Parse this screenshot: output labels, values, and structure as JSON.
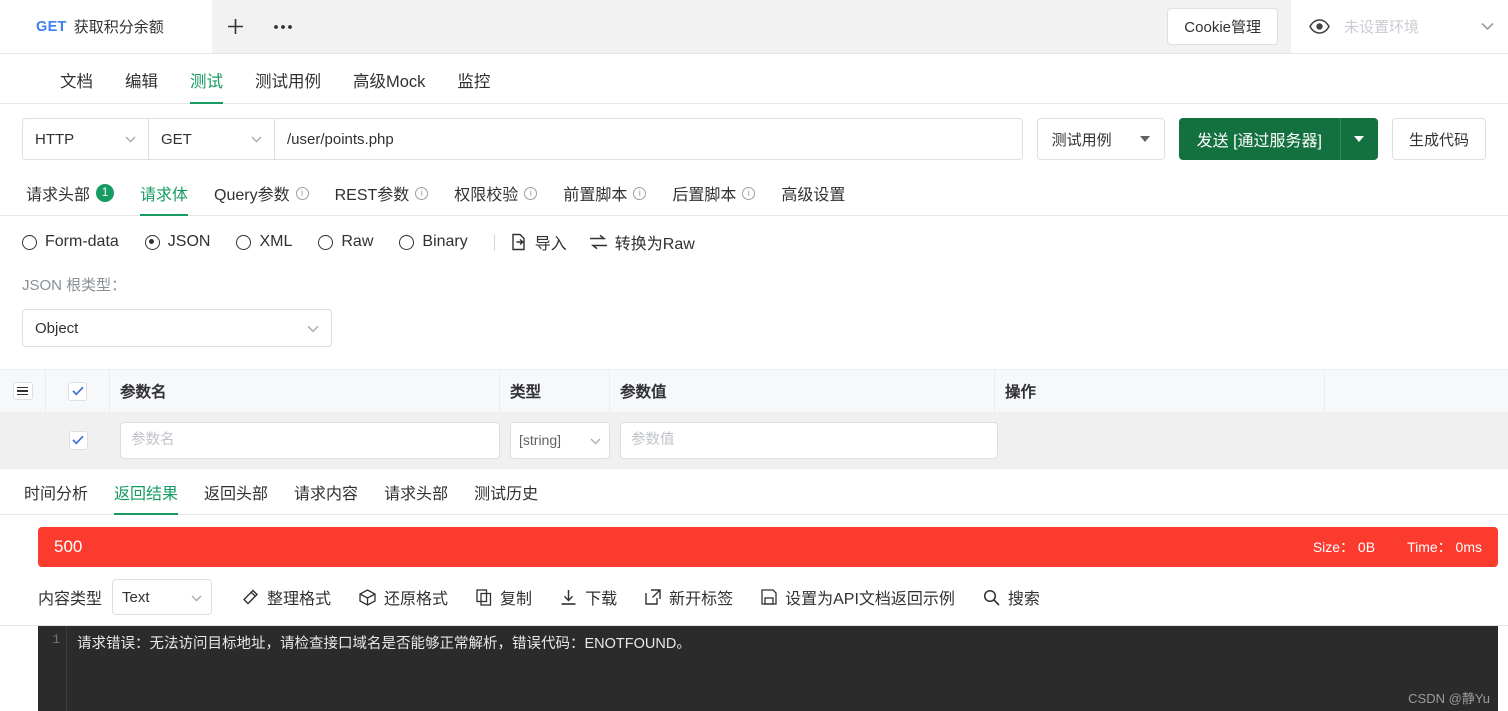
{
  "tabstrip": {
    "doc_tab": {
      "method": "GET",
      "title": "获取积分余额"
    },
    "add_label": "+",
    "more_label": "•••",
    "cookie_button": "Cookie管理",
    "env_placeholder": "未设置环境",
    "eye_icon": "eye-icon",
    "caret_icon": "chevron-down-icon"
  },
  "main_tabs": [
    {
      "label": "文档",
      "active": false
    },
    {
      "label": "编辑",
      "active": false
    },
    {
      "label": "测试",
      "active": true
    },
    {
      "label": "测试用例",
      "active": false
    },
    {
      "label": "高级Mock",
      "active": false
    },
    {
      "label": "监控",
      "active": false
    }
  ],
  "urlbar": {
    "protocol": "HTTP",
    "method": "GET",
    "url_value": "/user/points.php",
    "url_placeholder": "",
    "case_button": "测试用例",
    "send_button": "发送 [通过服务器]",
    "gen_code_button": "生成代码"
  },
  "request_tabs": [
    {
      "label": "请求头部",
      "badge": "1",
      "info": false,
      "active": false
    },
    {
      "label": "请求体",
      "badge": "",
      "info": false,
      "active": true
    },
    {
      "label": "Query参数",
      "badge": "",
      "info": true,
      "active": false
    },
    {
      "label": "REST参数",
      "badge": "",
      "info": true,
      "active": false
    },
    {
      "label": "权限校验",
      "badge": "",
      "info": true,
      "active": false
    },
    {
      "label": "前置脚本",
      "badge": "",
      "info": true,
      "active": false
    },
    {
      "label": "后置脚本",
      "badge": "",
      "info": true,
      "active": false
    },
    {
      "label": "高级设置",
      "badge": "",
      "info": false,
      "active": false
    }
  ],
  "body_types": {
    "options": [
      {
        "label": "Form-data",
        "selected": false
      },
      {
        "label": "JSON",
        "selected": true
      },
      {
        "label": "XML",
        "selected": false
      },
      {
        "label": "Raw",
        "selected": false
      },
      {
        "label": "Binary",
        "selected": false
      }
    ],
    "import_label": "导入",
    "convert_label": "转换为Raw"
  },
  "json_root": {
    "label": "JSON 根类型：",
    "selected": "Object"
  },
  "param_table": {
    "headers": {
      "name": "参数名",
      "type": "类型",
      "value": "参数值",
      "action": "操作"
    },
    "rows": [
      {
        "checked": true,
        "name_placeholder": "参数名",
        "type": "[string]",
        "value_placeholder": "参数值"
      }
    ]
  },
  "response_tabs": [
    {
      "label": "时间分析",
      "active": false
    },
    {
      "label": "返回结果",
      "active": true
    },
    {
      "label": "返回头部",
      "active": false
    },
    {
      "label": "请求内容",
      "active": false
    },
    {
      "label": "请求头部",
      "active": false
    },
    {
      "label": "测试历史",
      "active": false
    }
  ],
  "status": {
    "code": "500",
    "size": "Size： 0B",
    "time": "Time： 0ms",
    "color": "#fb3b2e"
  },
  "response_toolbar": {
    "content_type_label": "内容类型",
    "content_type_value": "Text",
    "actions": [
      {
        "label": "整理格式",
        "icon": "magic-wand-icon"
      },
      {
        "label": "还原格式",
        "icon": "box-icon"
      },
      {
        "label": "复制",
        "icon": "copy-icon"
      },
      {
        "label": "下载",
        "icon": "download-icon"
      },
      {
        "label": "新开标签",
        "icon": "external-link-icon"
      },
      {
        "label": "设置为API文档返回示例",
        "icon": "save-icon"
      },
      {
        "label": "搜索",
        "icon": "search-icon"
      }
    ]
  },
  "code": {
    "line_number": "1",
    "text": "请求错误：无法访问目标地址，请检查接口域名是否能够正常解析，错误代码：ENOTFOUND。",
    "watermark": "CSDN @静Yu"
  }
}
